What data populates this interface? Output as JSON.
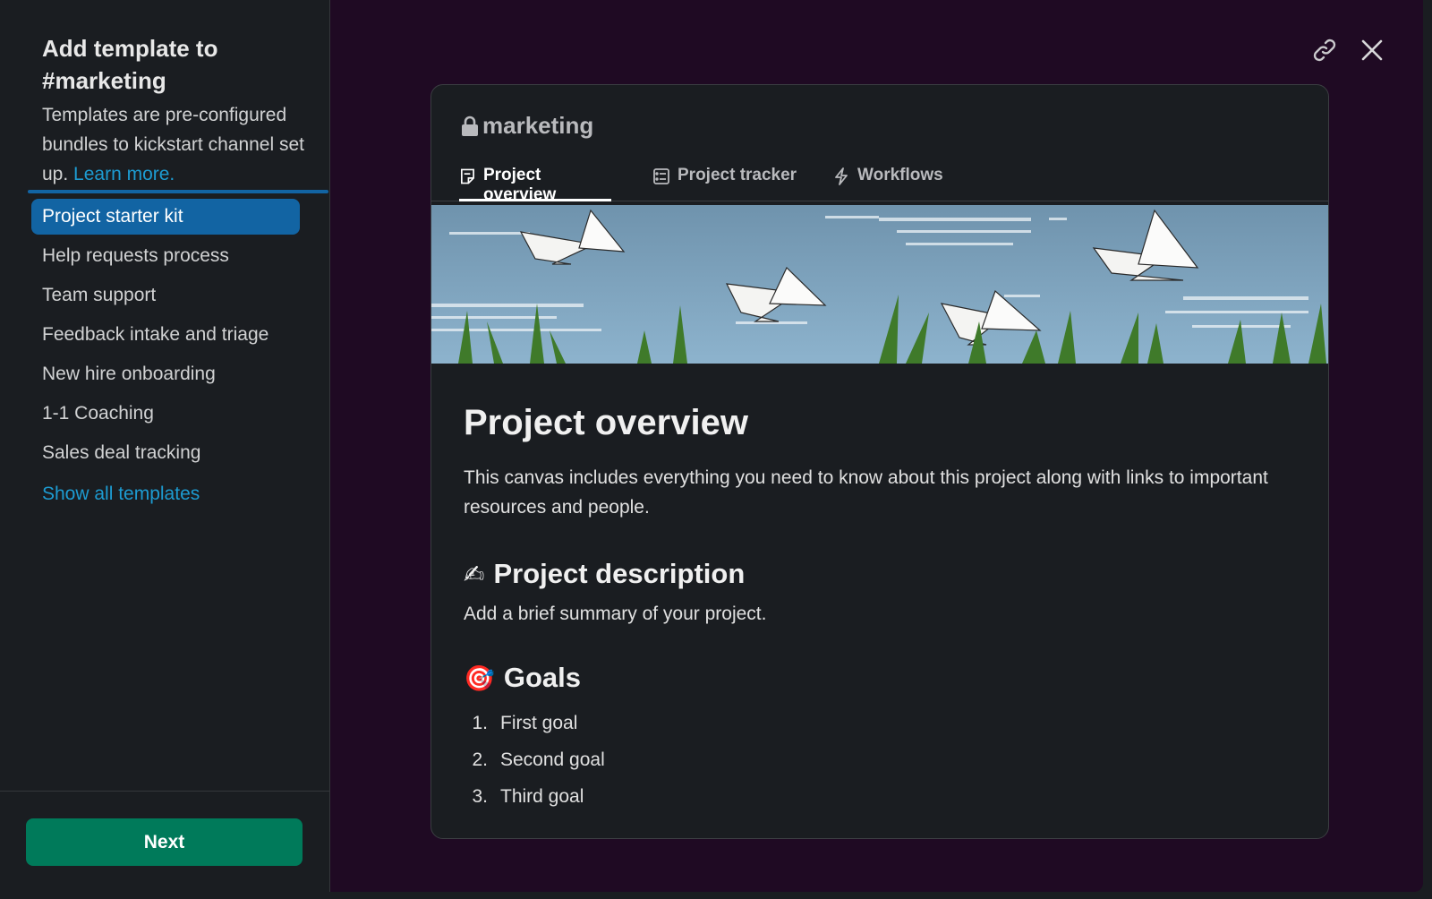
{
  "sidebar": {
    "title": "Add template to #marketing",
    "description": "Templates are pre-configured bundles to kickstart channel set up.",
    "learn_more": "Learn more.",
    "templates": [
      {
        "label": "Project starter kit",
        "active": true
      },
      {
        "label": "Help requests process"
      },
      {
        "label": "Team support"
      },
      {
        "label": "Feedback intake and triage"
      },
      {
        "label": "New hire onboarding"
      },
      {
        "label": "1-1 Coaching"
      },
      {
        "label": "Sales deal tracking"
      }
    ],
    "show_all": "Show all templates",
    "next_button": "Next"
  },
  "header_icons": {
    "link": "link-icon",
    "close": "close-icon"
  },
  "preview": {
    "channel_name": "marketing",
    "tabs": [
      {
        "label": "Project overview",
        "icon": "canvas-icon",
        "active": true
      },
      {
        "label": "Project tracker",
        "icon": "list-icon"
      },
      {
        "label": "Workflows",
        "icon": "lightning-icon"
      }
    ],
    "title": "Project overview",
    "intro": "This canvas includes everything you need to know about this project along with links to important resources and people.",
    "description_heading": "Project description",
    "description_emoji": "✍",
    "description_text": "Add a brief summary of your project.",
    "goals_heading": "Goals",
    "goals_emoji": "🎯",
    "goals": [
      {
        "num": "1.",
        "text": "First goal"
      },
      {
        "num": "2.",
        "text": "Second goal"
      },
      {
        "num": "3.",
        "text": "Third goal"
      }
    ]
  },
  "colors": {
    "accent_blue": "#1264a3",
    "link_blue": "#1d9bd1",
    "next_green": "#007a5a",
    "backdrop": "#1f0a23"
  }
}
